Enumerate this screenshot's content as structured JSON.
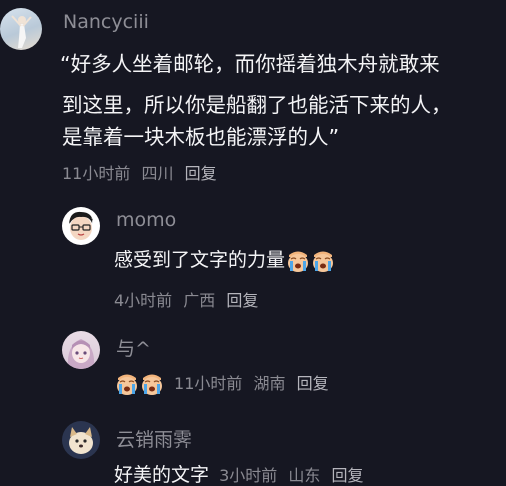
{
  "comments": [
    {
      "username": "Nancyciii",
      "lines": [
        "“好多人坐着邮轮，而你摇着独木舟就敢来",
        "到这里，所以你是船翻了也能活下来的人，",
        "是靠着一块木板也能漂浮的人”"
      ],
      "time": "11小时前",
      "location": "四川",
      "reply_label": "回复"
    },
    {
      "username": "momo",
      "text": "感受到了文字的力量",
      "emojis": [
        "crying-face-icon",
        "crying-face-icon"
      ],
      "time": "4小时前",
      "location": "广西",
      "reply_label": "回复"
    },
    {
      "username": "与^",
      "emojis": [
        "crying-face-icon",
        "crying-face-icon"
      ],
      "time": "11小时前",
      "location": "湖南",
      "reply_label": "回复"
    },
    {
      "username": "云销雨霁",
      "text": "好美的文字",
      "time": "3小时前",
      "location": "山东",
      "reply_label": "回复"
    }
  ]
}
